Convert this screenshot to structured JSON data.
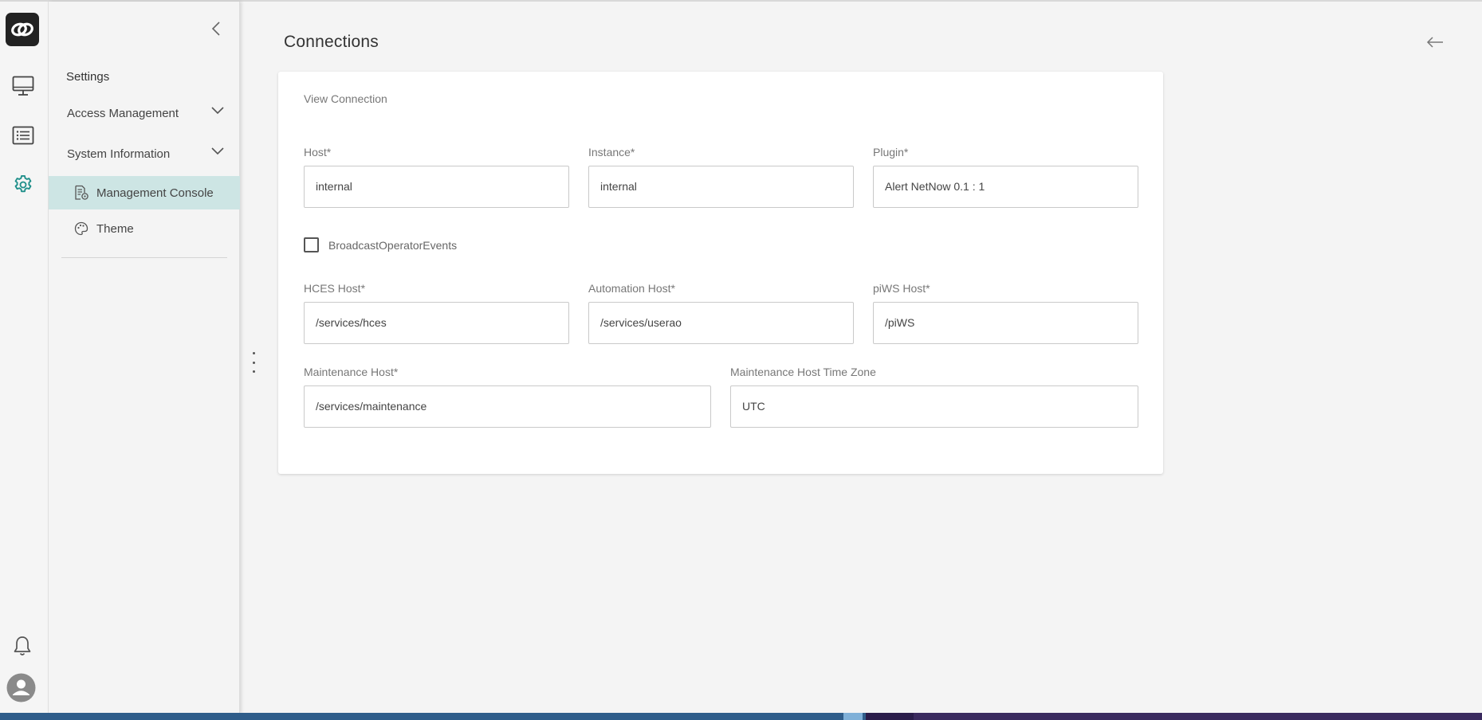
{
  "colors": {
    "accent": "#1f8f8a",
    "active_bg": "#cde5e4",
    "logo_bg": "#222222"
  },
  "rail": {
    "items": [
      {
        "icon": "monitor-icon"
      },
      {
        "icon": "list-icon"
      },
      {
        "icon": "gear-icon",
        "active": true
      }
    ],
    "bottom": [
      {
        "icon": "bell-icon"
      },
      {
        "icon": "user-avatar-icon"
      }
    ]
  },
  "panel": {
    "title": "Settings",
    "groups": [
      {
        "label": "Access Management",
        "icon": "chevron-down-icon"
      },
      {
        "label": "System Information",
        "icon": "chevron-down-icon"
      }
    ],
    "items": [
      {
        "label": "Management Console",
        "icon": "document-gear-icon",
        "active": true
      },
      {
        "label": "Theme",
        "icon": "palette-icon",
        "active": false
      }
    ]
  },
  "page": {
    "title": "Connections"
  },
  "card": {
    "title": "View Connection",
    "fields": {
      "host": {
        "label": "Host*",
        "value": "internal"
      },
      "instance": {
        "label": "Instance*",
        "value": "internal"
      },
      "plugin": {
        "label": "Plugin*",
        "value": "Alert NetNow 0.1 : 1"
      },
      "hces_host": {
        "label": "HCES Host*",
        "value": "/services/hces"
      },
      "automation_host": {
        "label": "Automation Host*",
        "value": "/services/userao"
      },
      "piws_host": {
        "label": "piWS Host*",
        "value": "/piWS"
      },
      "maintenance_host": {
        "label": "Maintenance Host*",
        "value": "/services/maintenance"
      },
      "maintenance_tz": {
        "label": "Maintenance Host Time Zone",
        "value": "UTC"
      }
    },
    "checkbox": {
      "label": "BroadcastOperatorEvents",
      "checked": false
    }
  }
}
